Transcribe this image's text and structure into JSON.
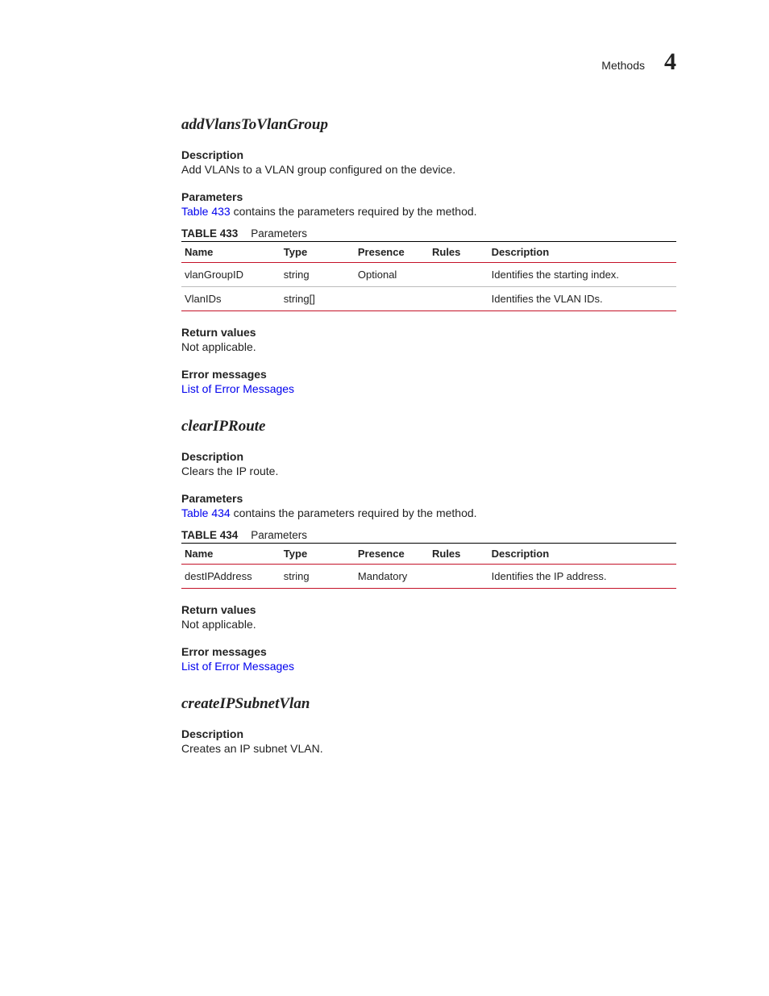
{
  "header": {
    "section": "Methods",
    "chapter": "4"
  },
  "common": {
    "label_description": "Description",
    "label_parameters": "Parameters",
    "label_return": "Return values",
    "label_errors": "Error messages",
    "return_na": "Not applicable.",
    "error_link": "List of Error Messages",
    "params_sentence_suffix": " contains the parameters required by the method."
  },
  "tables": {
    "headers": {
      "name": "Name",
      "type": "Type",
      "presence": "Presence",
      "rules": "Rules",
      "description": "Description"
    },
    "caption_word": "Parameters"
  },
  "methods": [
    {
      "name": "addVlansToVlanGroup",
      "description": "Add VLANs to a VLAN group configured on the device.",
      "table_ref": "Table 433",
      "table_num": "TABLE 433",
      "rows": [
        {
          "name": "vlanGroupID",
          "type": "string",
          "presence": "Optional",
          "rules": "",
          "description": "Identifies the starting index."
        },
        {
          "name": "VlanIDs",
          "type": "string[]",
          "presence": "",
          "rules": "",
          "description": "Identifies the VLAN IDs."
        }
      ]
    },
    {
      "name": "clearIPRoute",
      "description": "Clears the IP route.",
      "table_ref": "Table 434",
      "table_num": "TABLE 434",
      "rows": [
        {
          "name": "destIPAddress",
          "type": "string",
          "presence": "Mandatory",
          "rules": "",
          "description": "Identifies the IP address."
        }
      ]
    },
    {
      "name": "createIPSubnetVlan",
      "description": "Creates an IP subnet VLAN."
    }
  ]
}
